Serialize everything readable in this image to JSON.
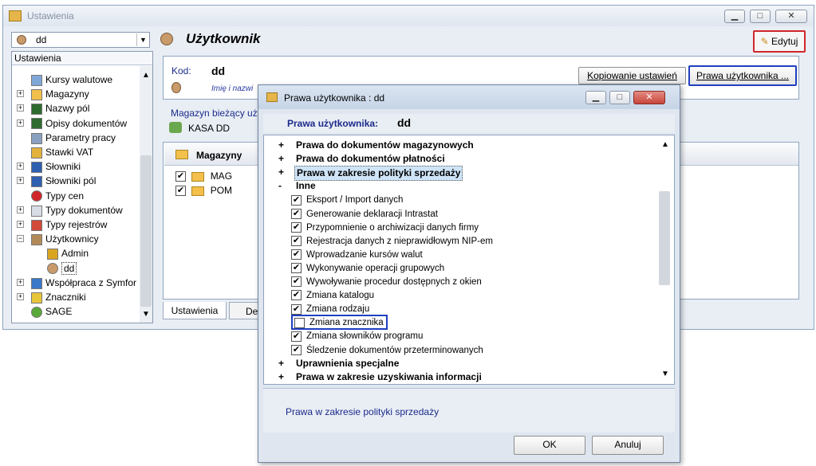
{
  "main_window": {
    "title": "Ustawienia",
    "controls": [
      "▁",
      "□",
      "✕"
    ]
  },
  "left_panel": {
    "user_combo_value": "dd",
    "header": "Ustawienia",
    "tree_items": [
      {
        "label": "Kursy walutowe",
        "icon": "chart-icon",
        "expandable": false
      },
      {
        "label": "Magazyny",
        "icon": "folder-icon",
        "expandable": true
      },
      {
        "label": "Nazwy pól",
        "icon": "az-icon",
        "expandable": true
      },
      {
        "label": "Opisy dokumentów",
        "icon": "az-icon",
        "expandable": true
      },
      {
        "label": "Parametry pracy",
        "icon": "computer-icon",
        "expandable": false
      },
      {
        "label": "Stawki VAT",
        "icon": "vat-icon",
        "expandable": false
      },
      {
        "label": "Słowniki",
        "icon": "az-blue-icon",
        "expandable": true
      },
      {
        "label": "Słowniki pól",
        "icon": "az-blue-icon",
        "expandable": true
      },
      {
        "label": "Typy cen",
        "icon": "red-dot-icon",
        "expandable": false
      },
      {
        "label": "Typy dokumentów",
        "icon": "document-icon",
        "expandable": true
      },
      {
        "label": "Typy rejestrów",
        "icon": "grid-icon",
        "expandable": true
      },
      {
        "label": "Użytkownicy",
        "icon": "users-icon",
        "expandable": true
      },
      {
        "label": "Admin",
        "icon": "key-icon",
        "expandable": false,
        "child": true
      },
      {
        "label": "dd",
        "icon": "user-icon",
        "expandable": false,
        "child": true,
        "selected": true
      },
      {
        "label": "Współpraca z Symfor",
        "icon": "sync-icon",
        "expandable": true
      },
      {
        "label": "Znaczniki",
        "icon": "a-icon",
        "expandable": true
      },
      {
        "label": "SAGE",
        "icon": "sage-icon",
        "expandable": false
      }
    ]
  },
  "right_panel": {
    "title": "Użytkownik",
    "edit_button": "Edytuj",
    "kod_label": "Kod:",
    "kod_value": "dd",
    "name_placeholder": "Imię i nazwi",
    "copy_button": "Kopiowanie ustawień",
    "rights_button": "Prawa użytkownika ...",
    "warehouse_label": "Magazyn bieżący użyt",
    "warehouse_value": "KASA DD",
    "warehouses_header": "Magazyny",
    "warehouses": [
      {
        "label": "MAG",
        "checked": true
      },
      {
        "label": "POM",
        "checked": true
      }
    ],
    "tabs": [
      "Ustawienia",
      "Det"
    ]
  },
  "dialog": {
    "title": "Prawa użytkownika : dd",
    "header_label": "Prawa użytkownika:",
    "header_value": "dd",
    "controls": [
      "▁",
      "□",
      "✕"
    ],
    "items": [
      {
        "type": "group",
        "sign": "+",
        "label": "Prawa do dokumentów magazynowych"
      },
      {
        "type": "group",
        "sign": "+",
        "label": "Prawa do dokumentów płatności"
      },
      {
        "type": "group",
        "sign": "+",
        "label": "Prawa w zakresie polityki sprzedaży",
        "highlighted": true
      },
      {
        "type": "group",
        "sign": "-",
        "label": "Inne"
      },
      {
        "type": "check",
        "checked": true,
        "label": "Eksport / Import danych"
      },
      {
        "type": "check",
        "checked": true,
        "label": "Generowanie deklaracji Intrastat"
      },
      {
        "type": "check",
        "checked": true,
        "label": "Przypomnienie o archiwizacji danych firmy"
      },
      {
        "type": "check",
        "checked": true,
        "label": "Rejestracja danych z nieprawidłowym NIP-em"
      },
      {
        "type": "check",
        "checked": true,
        "label": "Wprowadzanie kursów walut"
      },
      {
        "type": "check",
        "checked": true,
        "label": "Wykonywanie operacji grupowych"
      },
      {
        "type": "check",
        "checked": true,
        "label": "Wywoływanie procedur dostępnych z okien"
      },
      {
        "type": "check",
        "checked": true,
        "label": "Zmiana katalogu"
      },
      {
        "type": "check",
        "checked": true,
        "label": "Zmiana rodzaju"
      },
      {
        "type": "check",
        "checked": false,
        "label": "Zmiana znacznika",
        "boxed": true
      },
      {
        "type": "check",
        "checked": true,
        "label": "Zmiana słowników programu"
      },
      {
        "type": "check",
        "checked": true,
        "label": "Śledzenie dokumentów przeterminowanych"
      },
      {
        "type": "group",
        "sign": "+",
        "label": "Uprawnienia specjalne"
      },
      {
        "type": "group",
        "sign": "+",
        "label": "Prawa w zakresie uzyskiwania informacji"
      }
    ],
    "description": "Prawa w zakresie polityki sprzedaży",
    "ok_button": "OK",
    "cancel_button": "Anuluj"
  },
  "colors": {
    "highlight_red": "#d0262a",
    "highlight_blue": "#1f3fbf",
    "selection_bg": "#cfe5f7",
    "dialog_close": "#c7453a"
  }
}
